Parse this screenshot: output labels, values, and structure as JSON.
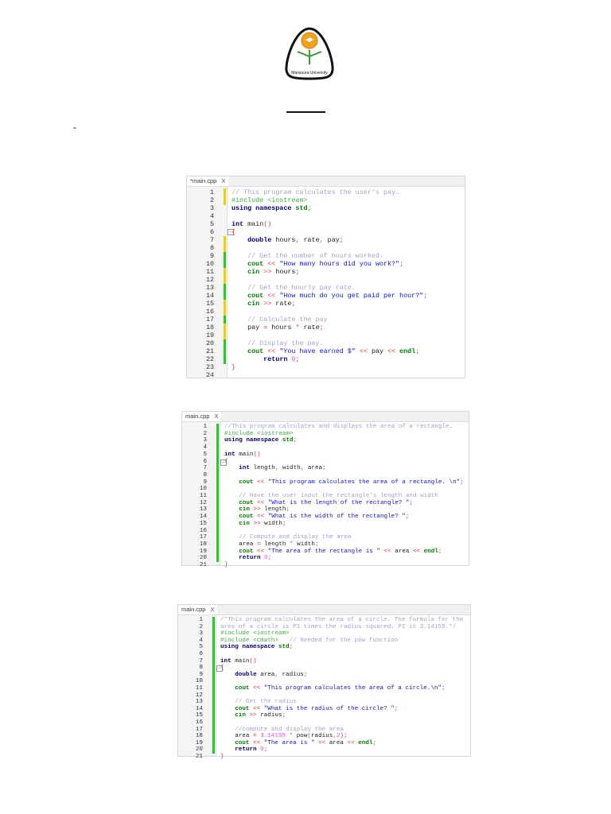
{
  "header": {
    "logo_text": "Mansoura University",
    "dash": "-"
  },
  "colors": {
    "marker_yellow": "#f0d000",
    "marker_green": "#22cc22"
  },
  "editors": [
    {
      "tab_label": "*main.cpp",
      "close_glyph": "X",
      "fold_line": 6,
      "lines": [
        {
          "m": "y",
          "t": [
            "cm|// This program calculates the user's pay."
          ]
        },
        {
          "m": "y",
          "t": [
            "pp|#include <iostream>"
          ]
        },
        {
          "m": "",
          "t": [
            "kw|using namespace ",
            "io|std",
            "op|;"
          ]
        },
        {
          "m": "",
          "t": []
        },
        {
          "m": "",
          "t": [
            "kw|int ",
            "id|main",
            "op|()"
          ]
        },
        {
          "m": "",
          "t": [
            "op|{"
          ]
        },
        {
          "m": "y",
          "t": [
            "id|    ",
            "kw|double ",
            "id|hours",
            "op|, ",
            "id|rate",
            "op|, ",
            "id|pay",
            "op|;"
          ]
        },
        {
          "m": "y",
          "t": []
        },
        {
          "m": "g",
          "t": [
            "id|    ",
            "cm|// Get the number of hours worked."
          ]
        },
        {
          "m": "g",
          "t": [
            "id|    ",
            "io|cout ",
            "op|<< ",
            "str|\"How many hours did you work?\"",
            "op|;"
          ]
        },
        {
          "m": "y",
          "t": [
            "id|    ",
            "io|cin ",
            "op|>> ",
            "id|hours",
            "op|;"
          ]
        },
        {
          "m": "y",
          "t": []
        },
        {
          "m": "g",
          "t": [
            "id|    ",
            "cm|// Get the hourly pay rate."
          ]
        },
        {
          "m": "g",
          "t": [
            "id|    ",
            "io|cout ",
            "op|<< ",
            "str|\"How much do you get paid per hour?\"",
            "op|;"
          ]
        },
        {
          "m": "y",
          "t": [
            "id|    ",
            "io|cin ",
            "op|>> ",
            "id|rate",
            "op|;"
          ]
        },
        {
          "m": "y",
          "t": []
        },
        {
          "m": "g",
          "t": [
            "id|    ",
            "cm|// Calculate the pay"
          ]
        },
        {
          "m": "y",
          "t": [
            "id|    pay ",
            "op|= ",
            "id|hours ",
            "op|* ",
            "id|rate",
            "op|;"
          ]
        },
        {
          "m": "y",
          "t": []
        },
        {
          "m": "g",
          "t": [
            "id|    ",
            "cm|// Display the pay."
          ]
        },
        {
          "m": "g",
          "t": [
            "id|    ",
            "io|cout ",
            "op|<< ",
            "str|\"You have earned $\" ",
            "op|<< ",
            "id|pay ",
            "op|<< ",
            "io|endl",
            "op|;"
          ]
        },
        {
          "m": "g",
          "t": [
            "id|        ",
            "kw|return ",
            "num|0",
            "op|;"
          ]
        },
        {
          "m": "",
          "t": [
            "op|}"
          ]
        },
        {
          "m": "",
          "t": []
        }
      ]
    },
    {
      "tab_label": "main.cpp",
      "close_glyph": "X",
      "fold_line": 6,
      "lines": [
        {
          "m": "g",
          "t": [
            "cm|//This program calculates and displays the area of a rectangle."
          ]
        },
        {
          "m": "g",
          "t": [
            "pp|#include <iostream>"
          ]
        },
        {
          "m": "g",
          "t": [
            "kw|using namespace ",
            "io|std",
            "op|;"
          ]
        },
        {
          "m": "g",
          "t": []
        },
        {
          "m": "g",
          "t": [
            "kw|int ",
            "id|main",
            "op|()"
          ]
        },
        {
          "m": "g",
          "t": [
            "op|{"
          ]
        },
        {
          "m": "g",
          "t": [
            "id|    ",
            "kw|int ",
            "id|length",
            "op|, ",
            "id|width",
            "op|, ",
            "id|area",
            "op|;"
          ]
        },
        {
          "m": "g",
          "t": []
        },
        {
          "m": "g",
          "t": [
            "id|    ",
            "io|cout ",
            "op|<< ",
            "str|\"This program calculates the area of a rectangle. \\n\"",
            "op|;"
          ]
        },
        {
          "m": "g",
          "t": []
        },
        {
          "m": "g",
          "t": [
            "id|    ",
            "cm|// Have the user input the rectangle's length and width"
          ]
        },
        {
          "m": "g",
          "t": [
            "id|    ",
            "io|cout ",
            "op|<< ",
            "str|\"What is the length of the rectangle? \"",
            "op|;"
          ]
        },
        {
          "m": "g",
          "t": [
            "id|    ",
            "io|cin ",
            "op|>> ",
            "id|length",
            "op|;"
          ]
        },
        {
          "m": "g",
          "t": [
            "id|    ",
            "io|cout ",
            "op|<< ",
            "str|\"What is the width of the rectangle? \"",
            "op|;"
          ]
        },
        {
          "m": "g",
          "t": [
            "id|    ",
            "io|cin ",
            "op|>> ",
            "id|width",
            "op|;"
          ]
        },
        {
          "m": "g",
          "t": []
        },
        {
          "m": "g",
          "t": [
            "id|    ",
            "cm|// Compute and display the area"
          ]
        },
        {
          "m": "g",
          "t": [
            "id|    area ",
            "op|= ",
            "id|length ",
            "op|* ",
            "id|width",
            "op|;"
          ]
        },
        {
          "m": "g",
          "t": [
            "id|    ",
            "io|cout ",
            "op|<< ",
            "str|\"The area of the rectangle is \" ",
            "op|<< ",
            "id|area ",
            "op|<< ",
            "io|endl",
            "op|;"
          ]
        },
        {
          "m": "g",
          "t": [
            "id|    ",
            "kw|return ",
            "num|0",
            "op|;"
          ]
        },
        {
          "m": "",
          "t": [
            "op|}"
          ]
        }
      ]
    },
    {
      "tab_label": "main.cpp",
      "close_glyph": "X",
      "fold_line": 8,
      "lines": [
        {
          "m": "g",
          "t": [
            "cm|/*This program calculates the area of a circle. The formula for the"
          ]
        },
        {
          "m": "g",
          "t": [
            "cm|area of a circle is PI times the radius squared. PI is 3.14159.*/"
          ]
        },
        {
          "m": "g",
          "t": [
            "pp|#include <iostream>"
          ]
        },
        {
          "m": "g",
          "t": [
            "pp|#include <cmath>   ",
            "cm|// Needed for the pow function"
          ]
        },
        {
          "m": "g",
          "t": [
            "kw|using namespace ",
            "io|std",
            "op|;"
          ]
        },
        {
          "m": "g",
          "t": []
        },
        {
          "m": "g",
          "t": [
            "kw|int ",
            "id|main",
            "op|()"
          ]
        },
        {
          "m": "g",
          "t": [
            "op|{"
          ]
        },
        {
          "m": "g",
          "t": [
            "id|    ",
            "kw|double ",
            "id|area",
            "op|, ",
            "id|radius",
            "op|;"
          ]
        },
        {
          "m": "g",
          "t": []
        },
        {
          "m": "g",
          "t": [
            "id|    ",
            "io|cout ",
            "op|<< ",
            "str|\"This program calculates the area of a circle.\\n\"",
            "op|;"
          ]
        },
        {
          "m": "g",
          "t": []
        },
        {
          "m": "g",
          "t": [
            "id|    ",
            "cm|// Get the radius"
          ]
        },
        {
          "m": "g",
          "t": [
            "id|    ",
            "io|cout ",
            "op|<< ",
            "str|\"What is the radius of the circle? \"",
            "op|;"
          ]
        },
        {
          "m": "g",
          "t": [
            "id|    ",
            "io|cin ",
            "op|>> ",
            "id|radius",
            "op|;"
          ]
        },
        {
          "m": "g",
          "t": []
        },
        {
          "m": "g",
          "t": [
            "id|    ",
            "cm|//compute and display the area"
          ]
        },
        {
          "m": "g",
          "t": [
            "id|    area ",
            "op|= ",
            "num|3.14159 ",
            "op|* ",
            "id|pow",
            "op|(",
            "id|radius",
            "op|,",
            "num|2",
            "op|);"
          ]
        },
        {
          "m": "g",
          "t": [
            "id|    ",
            "io|cout ",
            "op|<< ",
            "str|\"The area is \" ",
            "op|<< ",
            "id|area ",
            "op|<< ",
            "io|endl",
            "op|;"
          ]
        },
        {
          "m": "g",
          "t": [
            "id|    ",
            "kw|return ",
            "num|0",
            "op|;"
          ]
        },
        {
          "m": "",
          "t": [
            "op|}"
          ]
        }
      ]
    }
  ]
}
